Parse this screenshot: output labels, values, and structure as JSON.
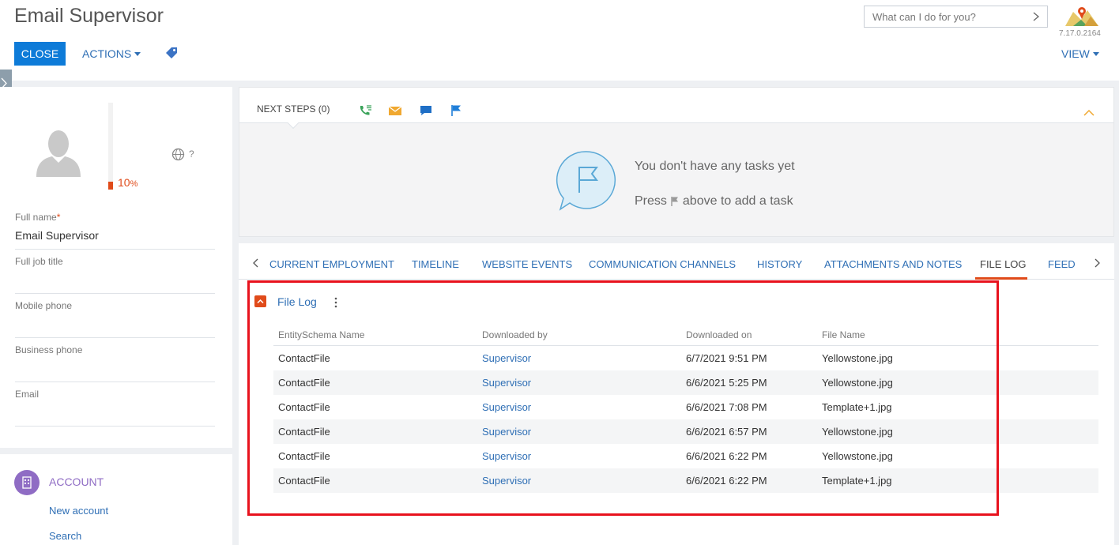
{
  "header": {
    "title": "Email Supervisor",
    "close_label": "CLOSE",
    "actions_label": "ACTIONS",
    "view_label": "VIEW",
    "search_placeholder": "What can I do for you?",
    "version": "7.17.0.2164"
  },
  "profile": {
    "completeness_percent": 10,
    "completeness_value": "10",
    "completeness_unit": "%",
    "timezone_hint": "?",
    "fields": [
      {
        "label": "Full name",
        "required_mark": "*",
        "value": "Email Supervisor"
      },
      {
        "label": "Full job title",
        "value": ""
      },
      {
        "label": "Mobile phone",
        "value": ""
      },
      {
        "label": "Business phone",
        "value": ""
      },
      {
        "label": "Email",
        "value": ""
      }
    ]
  },
  "account": {
    "title": "ACCOUNT",
    "links": [
      "New account",
      "Search"
    ]
  },
  "next_steps": {
    "title": "NEXT STEPS (0)",
    "empty_line1": "You don't have any tasks yet",
    "empty_line2_before": "Press",
    "empty_line2_after": "above to add a task",
    "icons": [
      "call-icon",
      "email-icon",
      "chat-icon",
      "flag-icon"
    ]
  },
  "tabs": {
    "items": [
      "CURRENT EMPLOYMENT",
      "TIMELINE",
      "WEBSITE EVENTS",
      "COMMUNICATION CHANNELS",
      "HISTORY",
      "ATTACHMENTS AND NOTES",
      "FILE LOG",
      "FEED"
    ],
    "active": "FILE LOG"
  },
  "file_log": {
    "title": "File Log",
    "columns": [
      "EntitySchema Name",
      "Downloaded by",
      "Downloaded on",
      "File Name"
    ],
    "rows": [
      [
        "ContactFile",
        "Supervisor",
        "6/7/2021 9:51 PM",
        "Yellowstone.jpg"
      ],
      [
        "ContactFile",
        "Supervisor",
        "6/6/2021 5:25 PM",
        "Yellowstone.jpg"
      ],
      [
        "ContactFile",
        "Supervisor",
        "6/6/2021 7:08 PM",
        "Template+1.jpg"
      ],
      [
        "ContactFile",
        "Supervisor",
        "6/6/2021 6:57 PM",
        "Yellowstone.jpg"
      ],
      [
        "ContactFile",
        "Supervisor",
        "6/6/2021 6:22 PM",
        "Yellowstone.jpg"
      ],
      [
        "ContactFile",
        "Supervisor",
        "6/6/2021 6:22 PM",
        "Template+1.jpg"
      ]
    ]
  },
  "colors": {
    "primary": "#0e7bd8",
    "link": "#2f6fb5",
    "accent": "#e04b1a",
    "highlight": "#e8121d",
    "account": "#8f6cc4"
  }
}
